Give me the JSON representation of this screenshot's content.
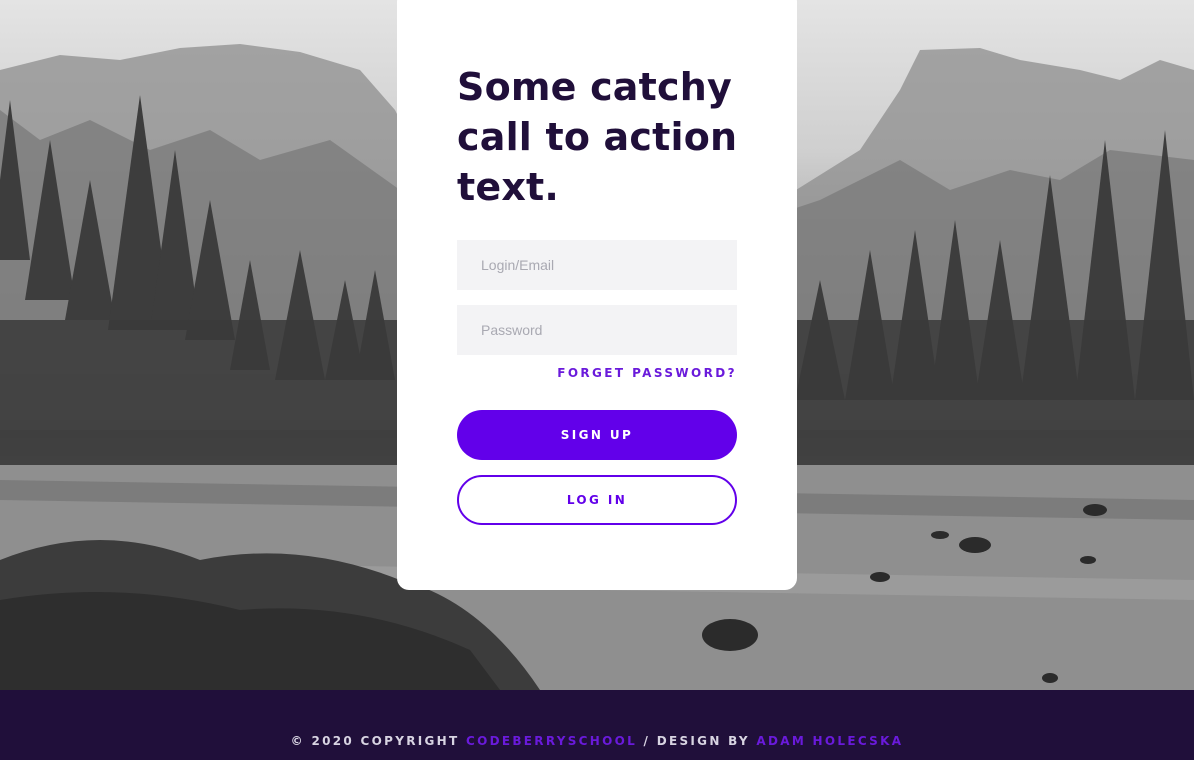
{
  "hero": {
    "headline": "Some catchy call to action text."
  },
  "form": {
    "login_placeholder": "Login/Email",
    "password_placeholder": "Password",
    "forgot_label": "FORGET PASSWORD?",
    "signup_label": "SIGN UP",
    "login_label": "LOG IN"
  },
  "footer": {
    "copyright_prefix": "© 2020 COPYRIGHT ",
    "school_link": "CODEBERRYSCHOOL",
    "design_by": " / DESIGN BY ",
    "designer_link": "ADAM HOLECSKA"
  },
  "colors": {
    "accent": "#6200ea",
    "link": "#6a1adb",
    "dark": "#200f3a",
    "field_bg": "#f3f3f5"
  }
}
